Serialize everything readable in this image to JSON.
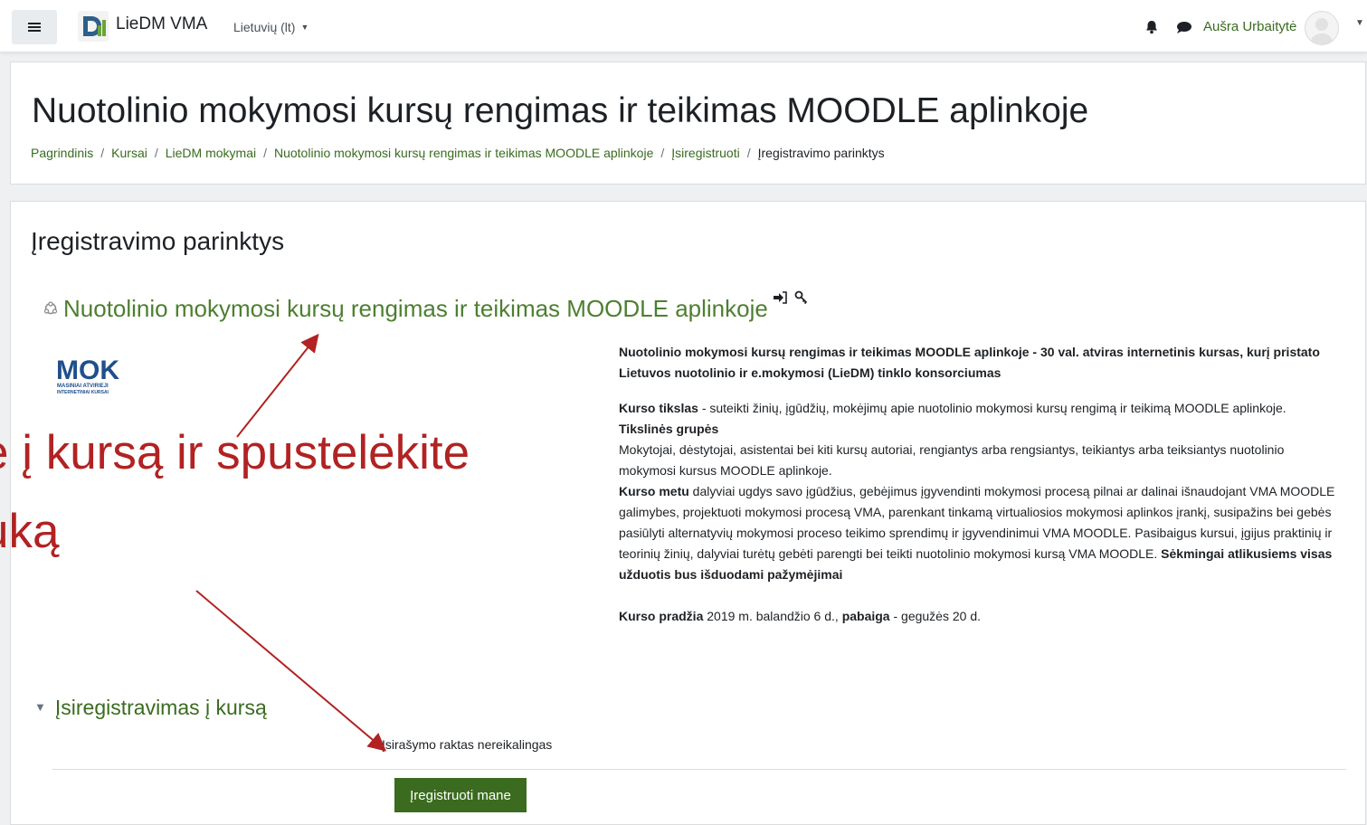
{
  "navbar": {
    "site_name": "LieDM VMA",
    "language": "Lietuvių (lt)",
    "user_name": "Aušra Urbaitytė"
  },
  "header": {
    "title": "Nuotolinio mokymosi kursų rengimas ir teikimas MOODLE aplinkoje",
    "breadcrumb": [
      "Pagrindinis",
      "Kursai",
      "LieDM mokymai",
      "Nuotolinio mokymosi kursų rengimas ir teikimas MOODLE aplinkoje",
      "Įsiregistruoti",
      "Įregistravimo parinktys"
    ]
  },
  "main": {
    "section_heading": "Įregistravimo parinktys",
    "course_name": "Nuotolinio mokymosi kursų rengimas ir teikimas MOODLE aplinkoje",
    "logo_text": "MOK",
    "logo_sub1": "MASINIAI ATVIRIEJI",
    "logo_sub2": "INTERNETINIAI KURSAI",
    "summary": {
      "lead": "Nuotolinio mokymosi kursų rengimas ir teikimas MOODLE aplinkoje - 30 val. atviras internetinis kursas, kurį pristato Lietuvos nuotolinio ir e.mokymosi (LieDM) tinklo konsorciumas",
      "goal_label": "Kurso tikslas",
      "goal_text": " - suteikti žinių, įgūdžių, mokėjimų apie nuotolinio mokymosi kursų rengimą ir teikimą MOODLE aplinkoje.",
      "groups_label": "Tikslinės grupės",
      "groups_text": "Mokytojai, dėstytojai, asistentai bei kiti kursų autoriai, rengiantys arba rengsiantys, teikiantys arba teiksiantys nuotolinio mokymosi kursus MOODLE aplinkoje.",
      "during_label": "Kurso metu",
      "during_text": " dalyviai ugdys savo įgūdžius, gebėjimus įgyvendinti mokymosi procesą pilnai ar dalinai išnaudojant VMA MOODLE galimybes, projektuoti mokymosi procesą VMA, parenkant tinkamą virtualiosios mokymosi aplinkos įrankį, susipažins bei gebės pasiūlyti alternatyvių mokymosi proceso teikimo sprendimų ir įgyvendinimui VMA MOODLE. Pasibaigus kursui, įgijus praktinių ir teorinių žinių, dalyviai turėtų gebėti parengti bei teikti nuotolinio mokymosi kursą VMA MOODLE. ",
      "during_bold_end": "Sėkmingai atlikusiems visas užduotis bus išduodami pažymėjimai",
      "start_label": "Kurso pradžia",
      "start_text": " 2019 m. balandžio 6 d., ",
      "end_label": "pabaiga",
      "end_text": " - gegužės 20 d."
    },
    "enrol_heading": "Įsiregistravimas į kursą",
    "no_key_text": "Įsirašymo raktas nereikalingas",
    "enrol_button": "Įregistruoti mane"
  },
  "overlay": {
    "line1": "e į kursą ir spustelėkite",
    "line2": "uką"
  },
  "colors": {
    "brand_green": "#3a6b1f",
    "link_green": "#4d7f30",
    "annotation_red": "#b22222"
  }
}
